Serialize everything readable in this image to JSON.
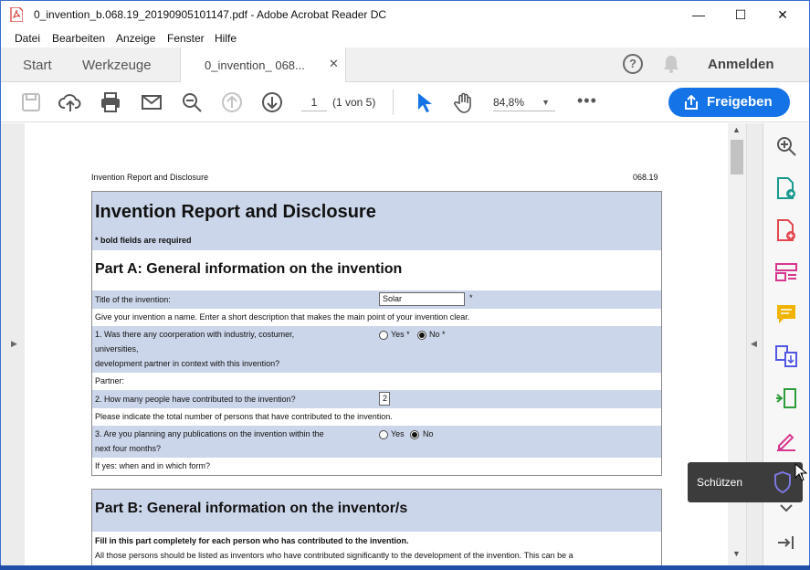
{
  "window": {
    "title": "0_invention_b‍.068.19_20190905101147.pdf - Adobe Acrobat Reader DC",
    "minimize": "—",
    "maximize": "☐",
    "close": "✕"
  },
  "menu": [
    "Datei",
    "Bearbeiten",
    "Anzeige",
    "Fenster",
    "Hilfe"
  ],
  "tabs": {
    "start": "Start",
    "tools": "Werkzeuge",
    "document": "0_invention_       068...",
    "document_close": "✕",
    "help": "?",
    "sign_in": "Anmelden"
  },
  "toolbar": {
    "icons": [
      "save-icon",
      "upload-icon",
      "print-icon",
      "email-icon",
      "zoom-out-icon",
      "page-up-icon",
      "page-down-icon",
      "select-cursor-icon",
      "hand-icon"
    ],
    "page_number": "1",
    "page_count": "(1 von 5)",
    "zoom": "84,8%",
    "more": "•••",
    "share_label": "Freigeben"
  },
  "document": {
    "header_left": "Invention Report and Disclosure",
    "header_right": "068.19",
    "title": "Invention Report and Disclosure",
    "required_note": "* bold fields are required",
    "part_a": "Part A: General information on the invention",
    "title_label": "Title of the invention:",
    "title_value": "Solar",
    "asterisk": "*",
    "title_hint": "Give your invention a name. Enter a short description that makes the main point of your invention clear.",
    "q1_line1": "1. Was there any coorperation with industriy, costumer,",
    "q1_line2": "universities,",
    "q1_line3": "development partner in context with this invention?",
    "yes_star": "Yes *",
    "no_star": "No *",
    "partner_label": "Partner:",
    "q2": "2. How many people have contributed to the invention?",
    "q2_value": "2",
    "q2_hint": "Please indicate the total number of persons that have contributed to the invention.",
    "q3_line1": "3. Are you planning any publications on the invention within the",
    "q3_line2": "next four months?",
    "yes": "Yes",
    "no": "No",
    "q3_followup": "If yes: when and in which form?",
    "part_b": "Part B: General information on the inventor/s",
    "part_b_fill": "Fill in this part completely for each person who has contributed to the invention.",
    "part_b_note": "All those persons should be listed as inventors who have contributed significantly to the development of the invention. This can be a"
  },
  "right_panel": {
    "icons": [
      "zoom-in-icon",
      "export-pdf-icon",
      "create-pdf-icon",
      "organize-pages-icon",
      "comment-icon",
      "combine-files-icon",
      "compress-icon",
      "fill-sign-icon",
      "protect-icon",
      "expand-more-icon",
      "collapse-panel-icon"
    ]
  },
  "tooltip": {
    "label": "Schützen"
  },
  "colors": {
    "share": "#1473e6",
    "form_band": "#ccd6ea",
    "tooltip_bg": "#3c3c3c",
    "protect": "#7b78e0"
  }
}
